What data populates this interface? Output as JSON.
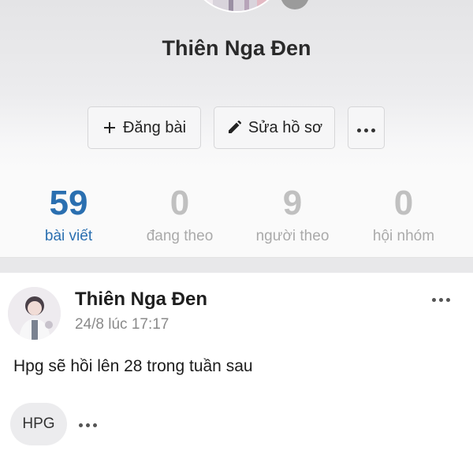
{
  "profile": {
    "name": "Thiên Nga Đen"
  },
  "actions": {
    "post_label": "Đăng bài",
    "edit_label": "Sửa hồ sơ",
    "more_icon": "more-horizontal-icon"
  },
  "stats": [
    {
      "value": "59",
      "label": "bài viết",
      "active": true
    },
    {
      "value": "0",
      "label": "đang theo",
      "active": false
    },
    {
      "value": "9",
      "label": "người theo",
      "active": false
    },
    {
      "value": "0",
      "label": "hội nhóm",
      "active": false
    }
  ],
  "post": {
    "author": "Thiên Nga Đen",
    "time": "24/8 lúc 17:17",
    "text": "Hpg sẽ hồi lên 28 trong tuần sau",
    "tag": "HPG"
  },
  "colors": {
    "accent": "#2a6fb0",
    "muted": "#c0c0c0"
  }
}
